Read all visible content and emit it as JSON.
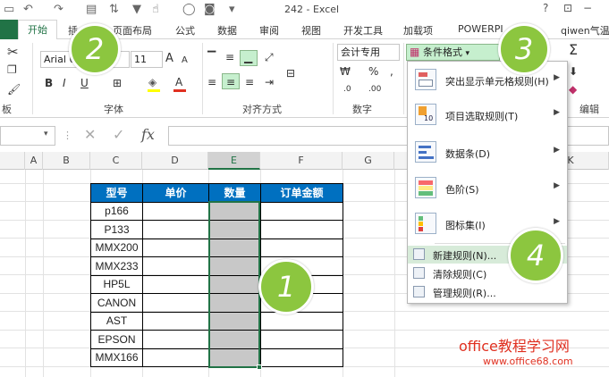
{
  "window": {
    "title": "242 - Excel",
    "help": "?",
    "minimize": "−",
    "restore": "▫",
    "close": "✕"
  },
  "tabs": [
    "开始",
    "插",
    "页面布局",
    "公式",
    "数据",
    "审阅",
    "视图",
    "开发工具",
    "加载项",
    "POWERPI",
    "qiwen气温"
  ],
  "ribbon": {
    "font_name": "Arial U",
    "font_size": "11",
    "number_format": "会计专用",
    "group_font": "字体",
    "group_align": "对齐方式",
    "group_number": "数字",
    "group_edit": "编辑",
    "group_clip": "板",
    "bold": "B",
    "italic": "I",
    "underline": "U",
    "grow_font": "A",
    "shrink_font": "A",
    "font_color": "A",
    "percent": "%",
    "comma": ",",
    "sum": "Σ",
    "cf_label": "条件格式",
    "accent": "#217346"
  },
  "formula": {
    "fx": "fx",
    "cancel": "✕",
    "enter": "✓"
  },
  "columns": [
    "A",
    "B",
    "C",
    "D",
    "E",
    "F",
    "G",
    "K"
  ],
  "table": {
    "headers": [
      "型号",
      "单价",
      "数量",
      "订单金额"
    ],
    "models": [
      "p166",
      "P133",
      "MMX200",
      "MMX233",
      "HP5L",
      "CANON",
      "AST",
      "EPSON",
      "MMX166"
    ],
    "header_color": "#0070c0",
    "qty_fill": "#c8c8c8"
  },
  "cf_menu": {
    "items": [
      "突出显示单元格规则(H)",
      "项目选取规则(T)",
      "数据条(D)",
      "色阶(S)",
      "图标集(I)"
    ],
    "small_items": [
      "新建规则(N)...",
      "清除规则(C)",
      "管理规则(R)..."
    ]
  },
  "badges": [
    "2",
    "3",
    "1",
    "4"
  ],
  "watermark": {
    "line1": "office教程学习网",
    "line2": "www.office68.com"
  }
}
